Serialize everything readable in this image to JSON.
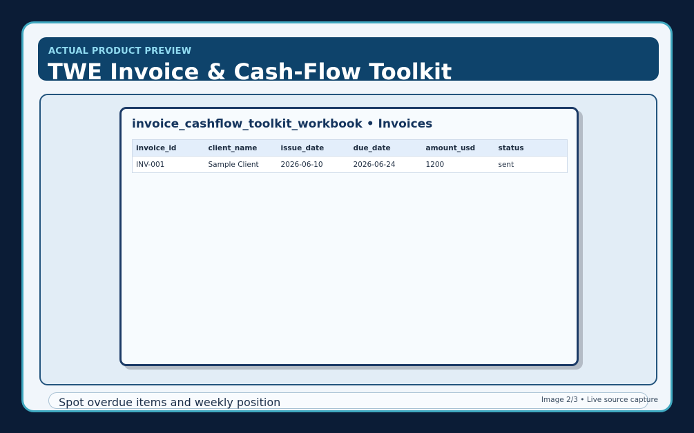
{
  "header": {
    "eyebrow": "ACTUAL PRODUCT PREVIEW",
    "title": "TWE Invoice & Cash-Flow Toolkit"
  },
  "sheet": {
    "title": "invoice_cashflow_toolkit_workbook • Invoices",
    "columns": [
      "invoice_id",
      "client_name",
      "issue_date",
      "due_date",
      "amount_usd",
      "status"
    ],
    "rows": [
      [
        "INV-001",
        "Sample Client",
        "2026-06-10",
        "2026-06-24",
        "1200",
        "sent"
      ]
    ]
  },
  "footer": {
    "caption": "Spot overdue items and weekly position",
    "image_counter": "Image 2/3 • Live source capture"
  },
  "colors": {
    "page_background": "#0b1c36",
    "frame_border": "#3fa8c0",
    "header_background": "#0e436b",
    "eyebrow_text": "#8fdaf0",
    "card_border": "#1b3a66"
  }
}
